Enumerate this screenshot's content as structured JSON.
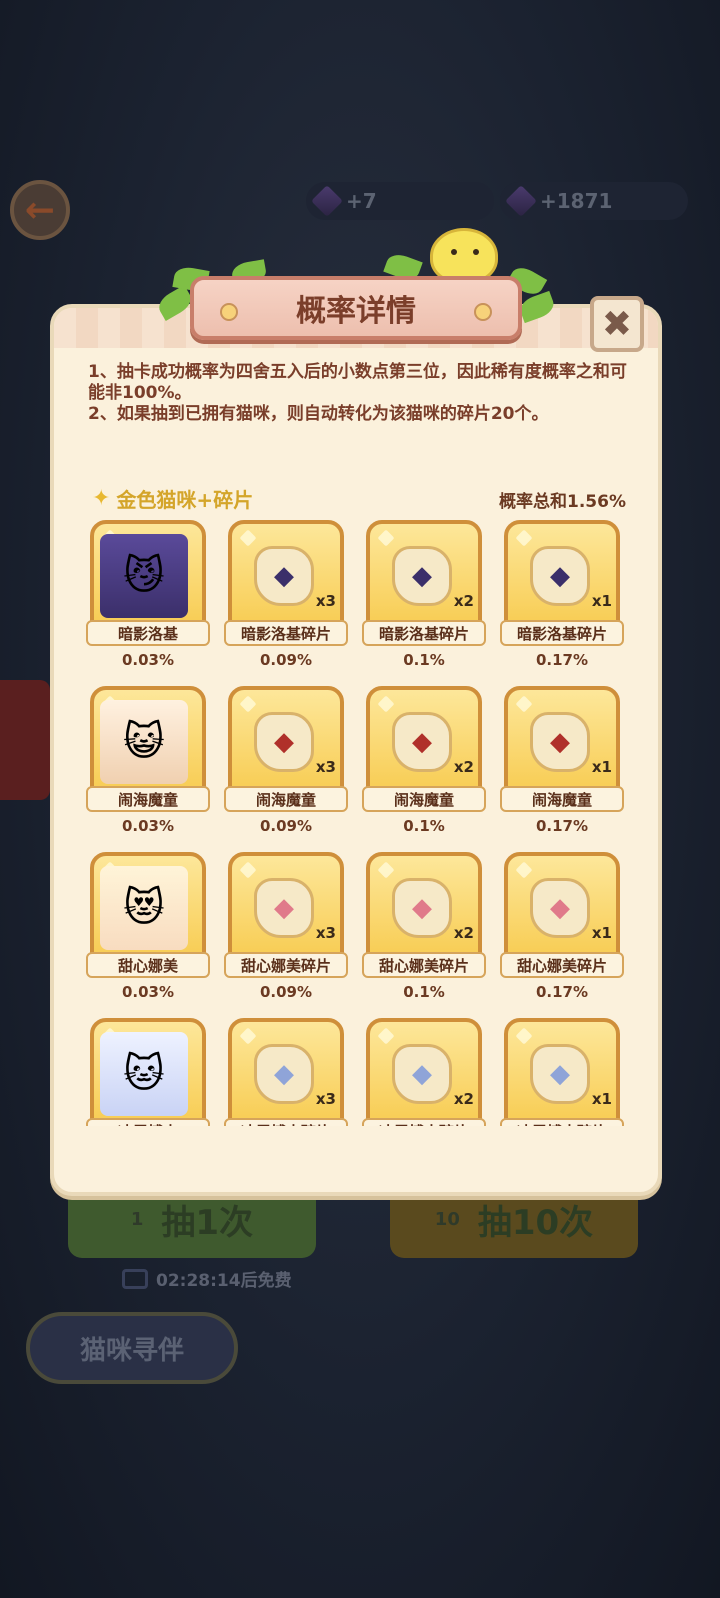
{
  "background": {
    "currency_small": "+7",
    "currency_gems": "+1871",
    "draw_once": {
      "label": "抽1次",
      "cost": "1"
    },
    "draw_ten": {
      "label": "抽10次",
      "cost": "10"
    },
    "free_timer": "02:28:14后免费",
    "companion_button": "猫咪寻伴"
  },
  "modal": {
    "title": "概率详情",
    "close_icon": "close-x-icon",
    "notes": [
      "1、抽卡成功概率为四舍五入后的小数点第三位，因此稀有度概率之和可能非100%。",
      "2、如果抽到已拥有猫咪，则自动转化为该猫咪的碎片20个。"
    ],
    "section": {
      "title": "金色猫咪+碎片",
      "sum": "概率总和1.56%"
    },
    "cards": [
      {
        "name": "暗影洛基",
        "prob": "0.03%",
        "mult": "",
        "kind": "cat",
        "icon": "shadow-cat"
      },
      {
        "name": "暗影洛基碎片",
        "prob": "0.09%",
        "mult": "x3",
        "kind": "shard",
        "icon": "shadow-cat-shard"
      },
      {
        "name": "暗影洛基碎片",
        "prob": "0.1%",
        "mult": "x2",
        "kind": "shard",
        "icon": "shadow-cat-shard"
      },
      {
        "name": "暗影洛基碎片",
        "prob": "0.17%",
        "mult": "x1",
        "kind": "shard",
        "icon": "shadow-cat-shard"
      },
      {
        "name": "闹海魔童",
        "prob": "0.03%",
        "mult": "",
        "kind": "cat",
        "icon": "sea-imp-cat"
      },
      {
        "name": "闹海魔童",
        "prob": "0.09%",
        "mult": "x3",
        "kind": "shard",
        "icon": "sea-imp-shard"
      },
      {
        "name": "闹海魔童",
        "prob": "0.1%",
        "mult": "x2",
        "kind": "shard",
        "icon": "sea-imp-shard"
      },
      {
        "name": "闹海魔童",
        "prob": "0.17%",
        "mult": "x1",
        "kind": "shard",
        "icon": "sea-imp-shard"
      },
      {
        "name": "甜心娜美",
        "prob": "0.03%",
        "mult": "",
        "kind": "cat",
        "icon": "sweet-cat"
      },
      {
        "name": "甜心娜美碎片",
        "prob": "0.09%",
        "mult": "x3",
        "kind": "shard",
        "icon": "sweet-cat-shard"
      },
      {
        "name": "甜心娜美碎片",
        "prob": "0.1%",
        "mult": "x2",
        "kind": "shard",
        "icon": "sweet-cat-shard"
      },
      {
        "name": "甜心娜美碎片",
        "prob": "0.17%",
        "mult": "x1",
        "kind": "shard",
        "icon": "sweet-cat-shard"
      },
      {
        "name": "冰雪博士",
        "prob": "",
        "mult": "",
        "kind": "cat",
        "icon": "ice-doctor-cat"
      },
      {
        "name": "冰雪博士碎片",
        "prob": "",
        "mult": "x3",
        "kind": "shard",
        "icon": "ice-doctor-shard"
      },
      {
        "name": "冰雪博士碎片",
        "prob": "",
        "mult": "x2",
        "kind": "shard",
        "icon": "ice-doctor-shard"
      },
      {
        "name": "冰雪博士碎片",
        "prob": "",
        "mult": "x1",
        "kind": "shard",
        "icon": "ice-doctor-shard"
      }
    ]
  },
  "colors": {
    "panel": "#fbf1dc",
    "title_text": "#7b3e2a",
    "section_gold": "#d4a52a",
    "card_gold": "#f7c94a",
    "card_border": "#cf8f3a"
  }
}
